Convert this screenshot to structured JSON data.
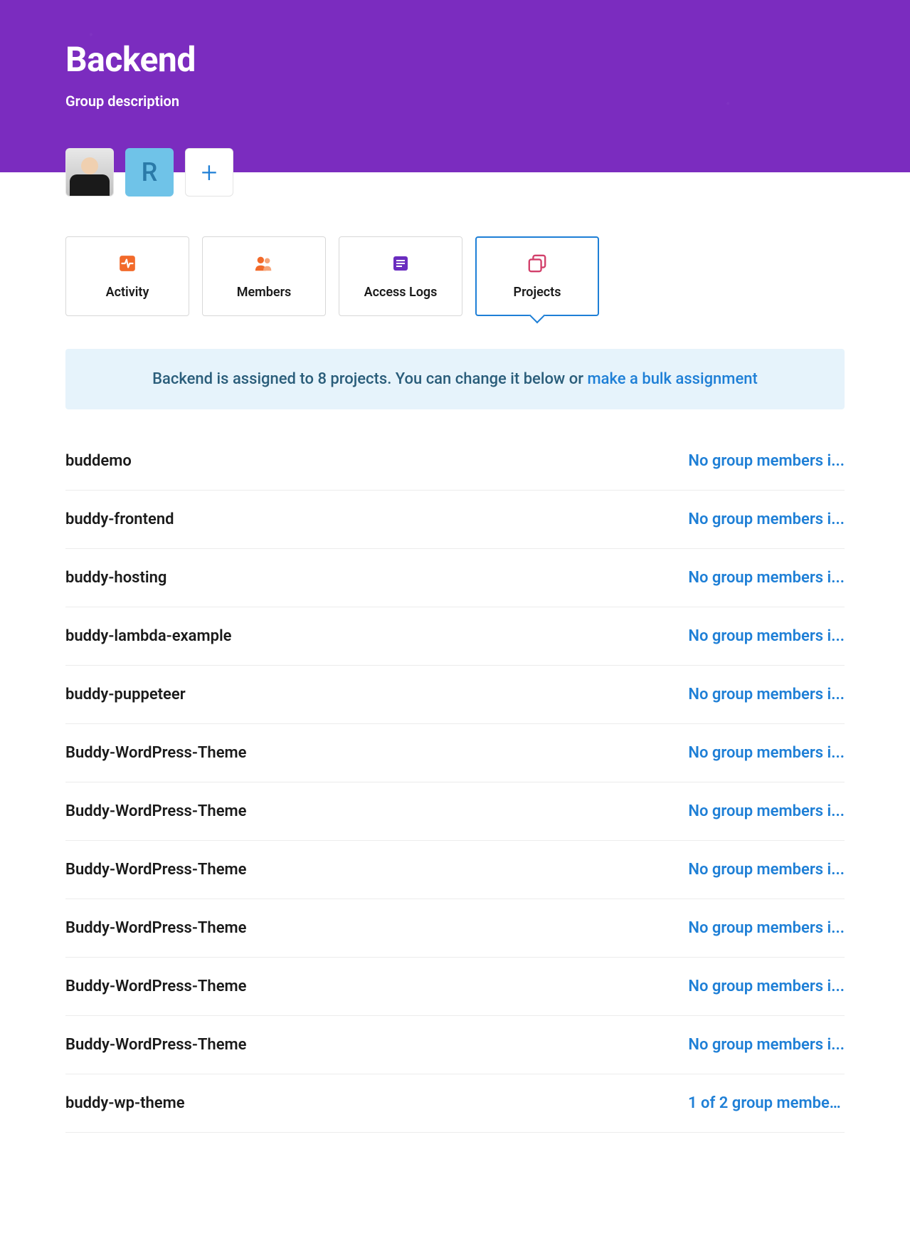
{
  "header": {
    "title": "Backend",
    "subtitle": "Group description"
  },
  "avatars": {
    "letter": "R",
    "add_symbol": "+"
  },
  "tabs": [
    {
      "key": "activity",
      "label": "Activity",
      "icon": "activity-icon",
      "color": "#f26a2a"
    },
    {
      "key": "members",
      "label": "Members",
      "icon": "members-icon",
      "color": "#f26a2a"
    },
    {
      "key": "access-logs",
      "label": "Access Logs",
      "icon": "access-logs-icon",
      "color": "#6a2cbf"
    },
    {
      "key": "projects",
      "label": "Projects",
      "icon": "projects-icon",
      "color": "#d23f6a",
      "active": true
    }
  ],
  "banner": {
    "text_prefix": "Backend is assigned to 8 projects. You can change it below or ",
    "link_text": "make a bulk assignment"
  },
  "projects": [
    {
      "name": "buddemo",
      "status": "No group members i..."
    },
    {
      "name": "buddy-frontend",
      "status": "No group members i..."
    },
    {
      "name": "buddy-hosting",
      "status": "No group members i..."
    },
    {
      "name": "buddy-lambda-example",
      "status": "No group members i..."
    },
    {
      "name": "buddy-puppeteer",
      "status": "No group members i..."
    },
    {
      "name": "Buddy-WordPress-Theme",
      "status": "No group members i..."
    },
    {
      "name": "Buddy-WordPress-Theme",
      "status": "No group members i..."
    },
    {
      "name": "Buddy-WordPress-Theme",
      "status": "No group members i..."
    },
    {
      "name": "Buddy-WordPress-Theme",
      "status": "No group members i..."
    },
    {
      "name": "Buddy-WordPress-Theme",
      "status": "No group members i..."
    },
    {
      "name": "Buddy-WordPress-Theme",
      "status": "No group members i..."
    },
    {
      "name": "buddy-wp-theme",
      "status": "1 of 2 group member..."
    }
  ]
}
